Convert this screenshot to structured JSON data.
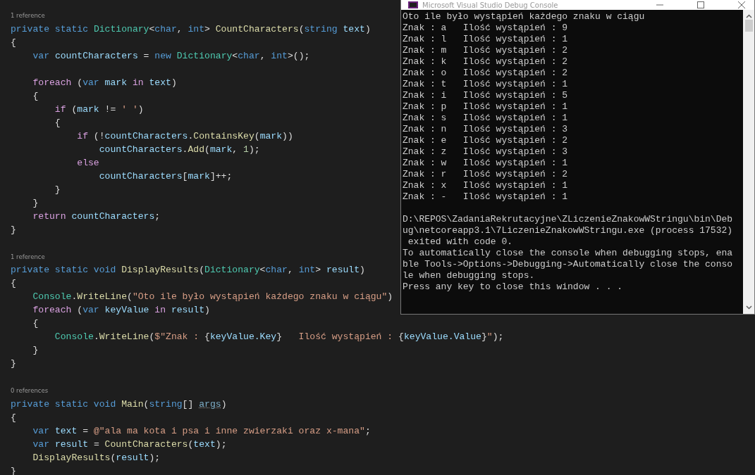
{
  "editor": {
    "methods": [
      {
        "codelens": "1 reference",
        "lines": [
          {
            "tokens": [
              {
                "kind": "kw",
                "text": "private static "
              },
              {
                "kind": "type",
                "text": "Dictionary"
              },
              {
                "kind": "p",
                "text": "<"
              },
              {
                "kind": "kw",
                "text": "char"
              },
              {
                "kind": "p",
                "text": ", "
              },
              {
                "kind": "kw",
                "text": "int"
              },
              {
                "kind": "p",
                "text": "> "
              },
              {
                "kind": "method",
                "text": "CountCharacters"
              },
              {
                "kind": "p",
                "text": "("
              },
              {
                "kind": "kw",
                "text": "string "
              },
              {
                "kind": "var",
                "text": "text"
              },
              {
                "kind": "p",
                "text": ")"
              }
            ]
          },
          {
            "tokens": [
              {
                "kind": "p",
                "text": "{"
              }
            ]
          },
          {
            "tokens": [
              {
                "kind": "kw",
                "text": "    var "
              },
              {
                "kind": "var",
                "text": "countCharacters"
              },
              {
                "kind": "p",
                "text": " = "
              },
              {
                "kind": "kw",
                "text": "new "
              },
              {
                "kind": "type",
                "text": "Dictionary"
              },
              {
                "kind": "p",
                "text": "<"
              },
              {
                "kind": "kw",
                "text": "char"
              },
              {
                "kind": "p",
                "text": ", "
              },
              {
                "kind": "kw",
                "text": "int"
              },
              {
                "kind": "p",
                "text": ">();"
              }
            ]
          },
          {
            "gap_before": true,
            "tokens": [
              {
                "kind": "ctl",
                "text": "    foreach"
              },
              {
                "kind": "p",
                "text": " ("
              },
              {
                "kind": "kw",
                "text": "var "
              },
              {
                "kind": "var",
                "text": "mark "
              },
              {
                "kind": "ctl",
                "text": "in "
              },
              {
                "kind": "var",
                "text": "text"
              },
              {
                "kind": "p",
                "text": ")"
              }
            ]
          },
          {
            "tokens": [
              {
                "kind": "p",
                "text": "    {"
              }
            ]
          },
          {
            "tokens": [
              {
                "kind": "ctl",
                "text": "        if"
              },
              {
                "kind": "p",
                "text": " ("
              },
              {
                "kind": "var",
                "text": "mark"
              },
              {
                "kind": "p",
                "text": " != "
              },
              {
                "kind": "str",
                "text": "' '"
              },
              {
                "kind": "p",
                "text": ")"
              }
            ]
          },
          {
            "tokens": [
              {
                "kind": "p",
                "text": "        {"
              }
            ]
          },
          {
            "tokens": [
              {
                "kind": "ctl",
                "text": "            if"
              },
              {
                "kind": "p",
                "text": " (!"
              },
              {
                "kind": "var",
                "text": "countCharacters"
              },
              {
                "kind": "p",
                "text": "."
              },
              {
                "kind": "method",
                "text": "ContainsKey"
              },
              {
                "kind": "p",
                "text": "("
              },
              {
                "kind": "var",
                "text": "mark"
              },
              {
                "kind": "p",
                "text": "))"
              }
            ]
          },
          {
            "tokens": [
              {
                "kind": "var",
                "text": "                countCharacters"
              },
              {
                "kind": "p",
                "text": "."
              },
              {
                "kind": "method",
                "text": "Add"
              },
              {
                "kind": "p",
                "text": "("
              },
              {
                "kind": "var",
                "text": "mark"
              },
              {
                "kind": "p",
                "text": ", "
              },
              {
                "kind": "num",
                "text": "1"
              },
              {
                "kind": "p",
                "text": ");"
              }
            ]
          },
          {
            "tokens": [
              {
                "kind": "ctl",
                "text": "            else"
              }
            ]
          },
          {
            "tokens": [
              {
                "kind": "var",
                "text": "                countCharacters"
              },
              {
                "kind": "p",
                "text": "["
              },
              {
                "kind": "var",
                "text": "mark"
              },
              {
                "kind": "p",
                "text": "]++;"
              }
            ]
          },
          {
            "tokens": [
              {
                "kind": "p",
                "text": "        }"
              }
            ]
          },
          {
            "tokens": [
              {
                "kind": "p",
                "text": "    }"
              }
            ]
          },
          {
            "tokens": [
              {
                "kind": "ctl",
                "text": "    return "
              },
              {
                "kind": "var",
                "text": "countCharacters"
              },
              {
                "kind": "p",
                "text": ";"
              }
            ]
          },
          {
            "tokens": [
              {
                "kind": "p",
                "text": "}"
              }
            ]
          }
        ]
      },
      {
        "codelens": "1 reference",
        "lines": [
          {
            "tokens": [
              {
                "kind": "kw",
                "text": "private static void "
              },
              {
                "kind": "method",
                "text": "DisplayResults"
              },
              {
                "kind": "p",
                "text": "("
              },
              {
                "kind": "type",
                "text": "Dictionary"
              },
              {
                "kind": "p",
                "text": "<"
              },
              {
                "kind": "kw",
                "text": "char"
              },
              {
                "kind": "p",
                "text": ", "
              },
              {
                "kind": "kw",
                "text": "int"
              },
              {
                "kind": "p",
                "text": "> "
              },
              {
                "kind": "var",
                "text": "result"
              },
              {
                "kind": "p",
                "text": ")"
              }
            ]
          },
          {
            "tokens": [
              {
                "kind": "p",
                "text": "{"
              }
            ]
          },
          {
            "tokens": [
              {
                "kind": "type",
                "text": "    Console"
              },
              {
                "kind": "p",
                "text": "."
              },
              {
                "kind": "method",
                "text": "WriteLine"
              },
              {
                "kind": "p",
                "text": "("
              },
              {
                "kind": "str",
                "text": "\"Oto ile było wystąpień każdego znaku w ciągu\""
              },
              {
                "kind": "p",
                "text": ")"
              }
            ]
          },
          {
            "tokens": [
              {
                "kind": "ctl",
                "text": "    foreach"
              },
              {
                "kind": "p",
                "text": " ("
              },
              {
                "kind": "kw",
                "text": "var "
              },
              {
                "kind": "var",
                "text": "keyValue "
              },
              {
                "kind": "ctl",
                "text": "in "
              },
              {
                "kind": "var",
                "text": "result"
              },
              {
                "kind": "p",
                "text": ")"
              }
            ]
          },
          {
            "tokens": [
              {
                "kind": "p",
                "text": "    {"
              }
            ]
          },
          {
            "tokens": [
              {
                "kind": "type",
                "text": "        Console"
              },
              {
                "kind": "p",
                "text": "."
              },
              {
                "kind": "method",
                "text": "WriteLine"
              },
              {
                "kind": "p",
                "text": "("
              },
              {
                "kind": "str",
                "text": "$\"Znak : "
              },
              {
                "kind": "p",
                "text": "{"
              },
              {
                "kind": "var",
                "text": "keyValue.Key"
              },
              {
                "kind": "p",
                "text": "}"
              },
              {
                "kind": "str",
                "text": "   Ilość wystąpień : "
              },
              {
                "kind": "p",
                "text": "{"
              },
              {
                "kind": "var",
                "text": "keyValue.Value"
              },
              {
                "kind": "p",
                "text": "}"
              },
              {
                "kind": "str",
                "text": "\""
              },
              {
                "kind": "p",
                "text": ");"
              }
            ]
          },
          {
            "tokens": [
              {
                "kind": "p",
                "text": "    }"
              }
            ]
          },
          {
            "tokens": [
              {
                "kind": "p",
                "text": "}"
              }
            ]
          }
        ]
      },
      {
        "codelens": "0 references",
        "lines": [
          {
            "tokens": [
              {
                "kind": "kw",
                "text": "private static void "
              },
              {
                "kind": "method",
                "text": "Main"
              },
              {
                "kind": "p",
                "text": "("
              },
              {
                "kind": "kw",
                "text": "string"
              },
              {
                "kind": "p",
                "text": "[] "
              },
              {
                "kind": "unused",
                "text": "args"
              },
              {
                "kind": "p",
                "text": ")"
              }
            ]
          },
          {
            "tokens": [
              {
                "kind": "p",
                "text": "{"
              }
            ]
          },
          {
            "tokens": [
              {
                "kind": "kw",
                "text": "    var "
              },
              {
                "kind": "var",
                "text": "text"
              },
              {
                "kind": "p",
                "text": " = "
              },
              {
                "kind": "str",
                "text": "@\"ala ma kota i psa i inne zwierzaki oraz x-mana\""
              },
              {
                "kind": "p",
                "text": ";"
              }
            ]
          },
          {
            "tokens": [
              {
                "kind": "kw",
                "text": "    var "
              },
              {
                "kind": "var",
                "text": "result"
              },
              {
                "kind": "p",
                "text": " = "
              },
              {
                "kind": "method",
                "text": "CountCharacters"
              },
              {
                "kind": "p",
                "text": "("
              },
              {
                "kind": "var",
                "text": "text"
              },
              {
                "kind": "p",
                "text": ");"
              }
            ]
          },
          {
            "tokens": [
              {
                "kind": "method",
                "text": "    DisplayResults"
              },
              {
                "kind": "p",
                "text": "("
              },
              {
                "kind": "var",
                "text": "result"
              },
              {
                "kind": "p",
                "text": ");"
              }
            ]
          },
          {
            "tokens": [
              {
                "kind": "p",
                "text": "}"
              }
            ]
          }
        ]
      }
    ]
  },
  "console": {
    "title": "Microsoft Visual Studio Debug Console",
    "output": [
      "Oto ile było wystąpień każdego znaku w ciągu",
      "Znak : a   Ilość wystąpień : 9",
      "Znak : l   Ilość wystąpień : 1",
      "Znak : m   Ilość wystąpień : 2",
      "Znak : k   Ilość wystąpień : 2",
      "Znak : o   Ilość wystąpień : 2",
      "Znak : t   Ilość wystąpień : 1",
      "Znak : i   Ilość wystąpień : 5",
      "Znak : p   Ilość wystąpień : 1",
      "Znak : s   Ilość wystąpień : 1",
      "Znak : n   Ilość wystąpień : 3",
      "Znak : e   Ilość wystąpień : 2",
      "Znak : z   Ilość wystąpień : 3",
      "Znak : w   Ilość wystąpień : 1",
      "Znak : r   Ilość wystąpień : 2",
      "Znak : x   Ilość wystąpień : 1",
      "Znak : -   Ilość wystąpień : 1"
    ],
    "messages": [
      "D:\\REPOS\\ZadaniaRekrutacyjne\\ZLiczenieZnakowWStringu\\bin\\Deb",
      "ug\\netcoreapp3.1\\7LiczenieZnakowWStringu.exe (process 17532)",
      " exited with code 0.",
      "To automatically close the console when debugging stops, ena",
      "ble Tools->Options->Debugging->Automatically close the conso",
      "le when debugging stops.",
      "Press any key to close this window . . ."
    ]
  }
}
